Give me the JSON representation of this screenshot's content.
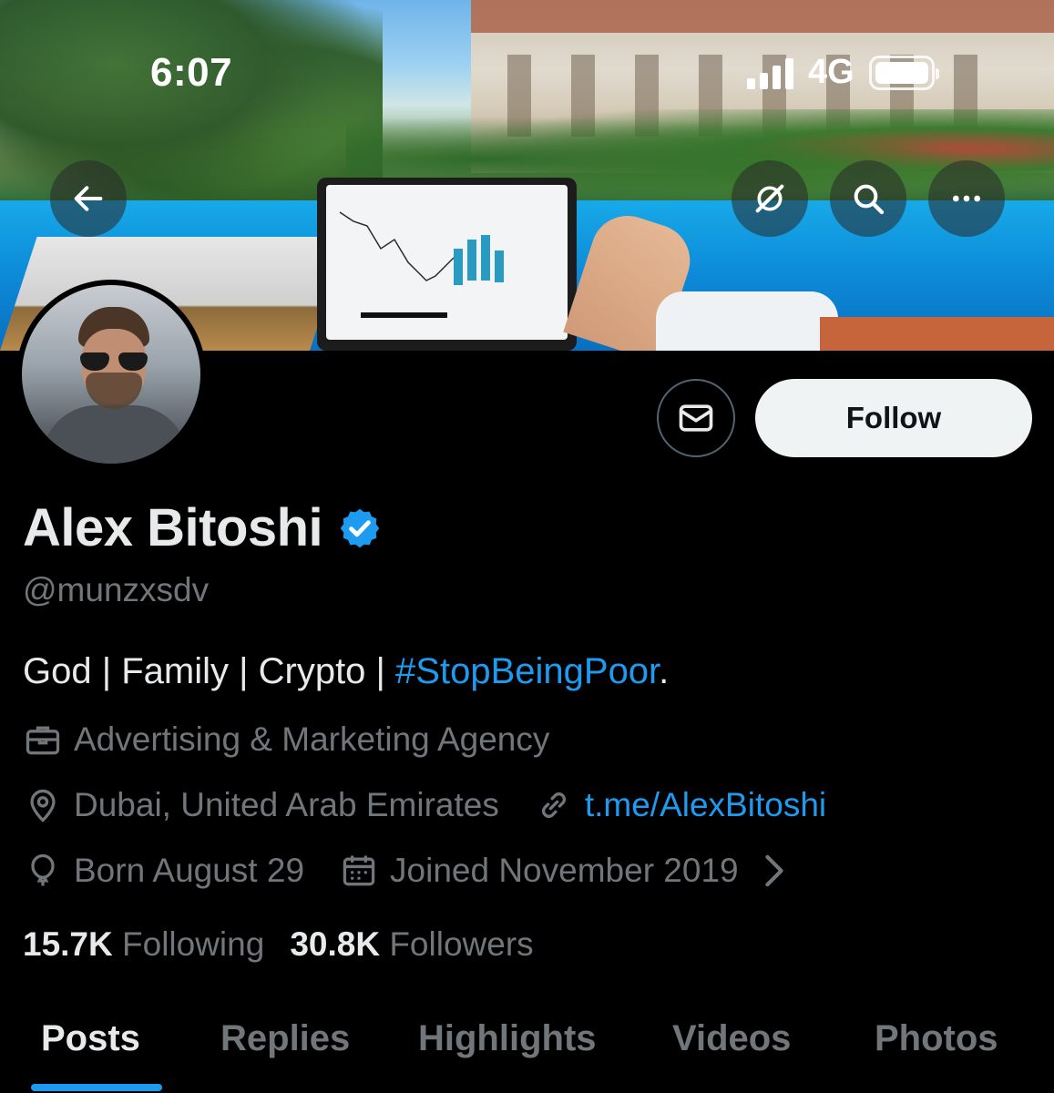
{
  "status_bar": {
    "time": "6:07",
    "network": "4G",
    "signal_bars": 4,
    "battery_level": 1.0
  },
  "banner": {
    "description_icon": "pool-resort-laptop-banner"
  },
  "header_actions": {
    "back_icon": "arrow-left-icon",
    "ai_icon": "grok-slash-icon",
    "search_icon": "search-icon",
    "more_icon": "ellipsis-icon"
  },
  "profile": {
    "display_name": "Alex Bitoshi",
    "handle": "@munzxsdv",
    "verified": true,
    "bio_text": "God | Family | Crypto | ",
    "bio_hashtag": "#StopBeingPoor",
    "bio_tail": ".",
    "category": "Advertising & Marketing Agency",
    "location": "Dubai, United Arab Emirates",
    "link": "t.me/AlexBitoshi",
    "birthday": "Born August 29",
    "joined": "Joined November 2019",
    "following_count": "15.7K",
    "following_label": "Following",
    "followers_count": "30.8K",
    "followers_label": "Followers"
  },
  "actions": {
    "follow_label": "Follow",
    "message_icon": "mail-icon"
  },
  "tabs": [
    {
      "label": "Posts",
      "active": true
    },
    {
      "label": "Replies",
      "active": false
    },
    {
      "label": "Highlights",
      "active": false
    },
    {
      "label": "Videos",
      "active": false
    },
    {
      "label": "Photos",
      "active": false
    }
  ],
  "colors": {
    "accent": "#1d9bf0",
    "background": "#000000",
    "muted": "#71767b",
    "text": "#e7e9ea"
  }
}
